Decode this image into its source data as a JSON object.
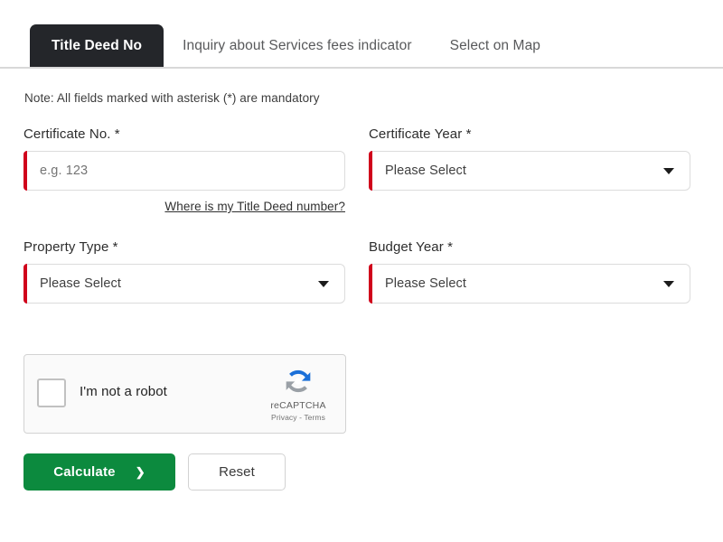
{
  "tabs": [
    {
      "label": "Title Deed No",
      "active": true
    },
    {
      "label": "Inquiry about Services fees indicator",
      "active": false
    },
    {
      "label": "Select on Map",
      "active": false
    }
  ],
  "note": "Note: All fields marked with asterisk (*) are mandatory",
  "fields": {
    "certificate_no": {
      "label": "Certificate No. *",
      "placeholder": "e.g. 123",
      "value": "",
      "helper_link": "Where is my Title Deed number?"
    },
    "certificate_year": {
      "label": "Certificate Year *",
      "selected": "Please Select"
    },
    "property_type": {
      "label": "Property Type *",
      "selected": "Please Select"
    },
    "budget_year": {
      "label": "Budget Year *",
      "selected": "Please Select"
    }
  },
  "recaptcha": {
    "checkbox_label": "I'm not a robot",
    "brand": "reCAPTCHA",
    "legal": "Privacy - Terms",
    "logo_icon": "recaptcha-circular-arrows-icon"
  },
  "buttons": {
    "calculate": "Calculate",
    "calculate_icon": "chevron-right-icon",
    "reset": "Reset"
  },
  "colors": {
    "accent_red": "#d0021b",
    "primary_green": "#0c8a3e",
    "active_tab_bg": "#24262a",
    "recaptcha_blue": "#1c70d8",
    "recaptcha_gray": "#9aa0a6"
  }
}
